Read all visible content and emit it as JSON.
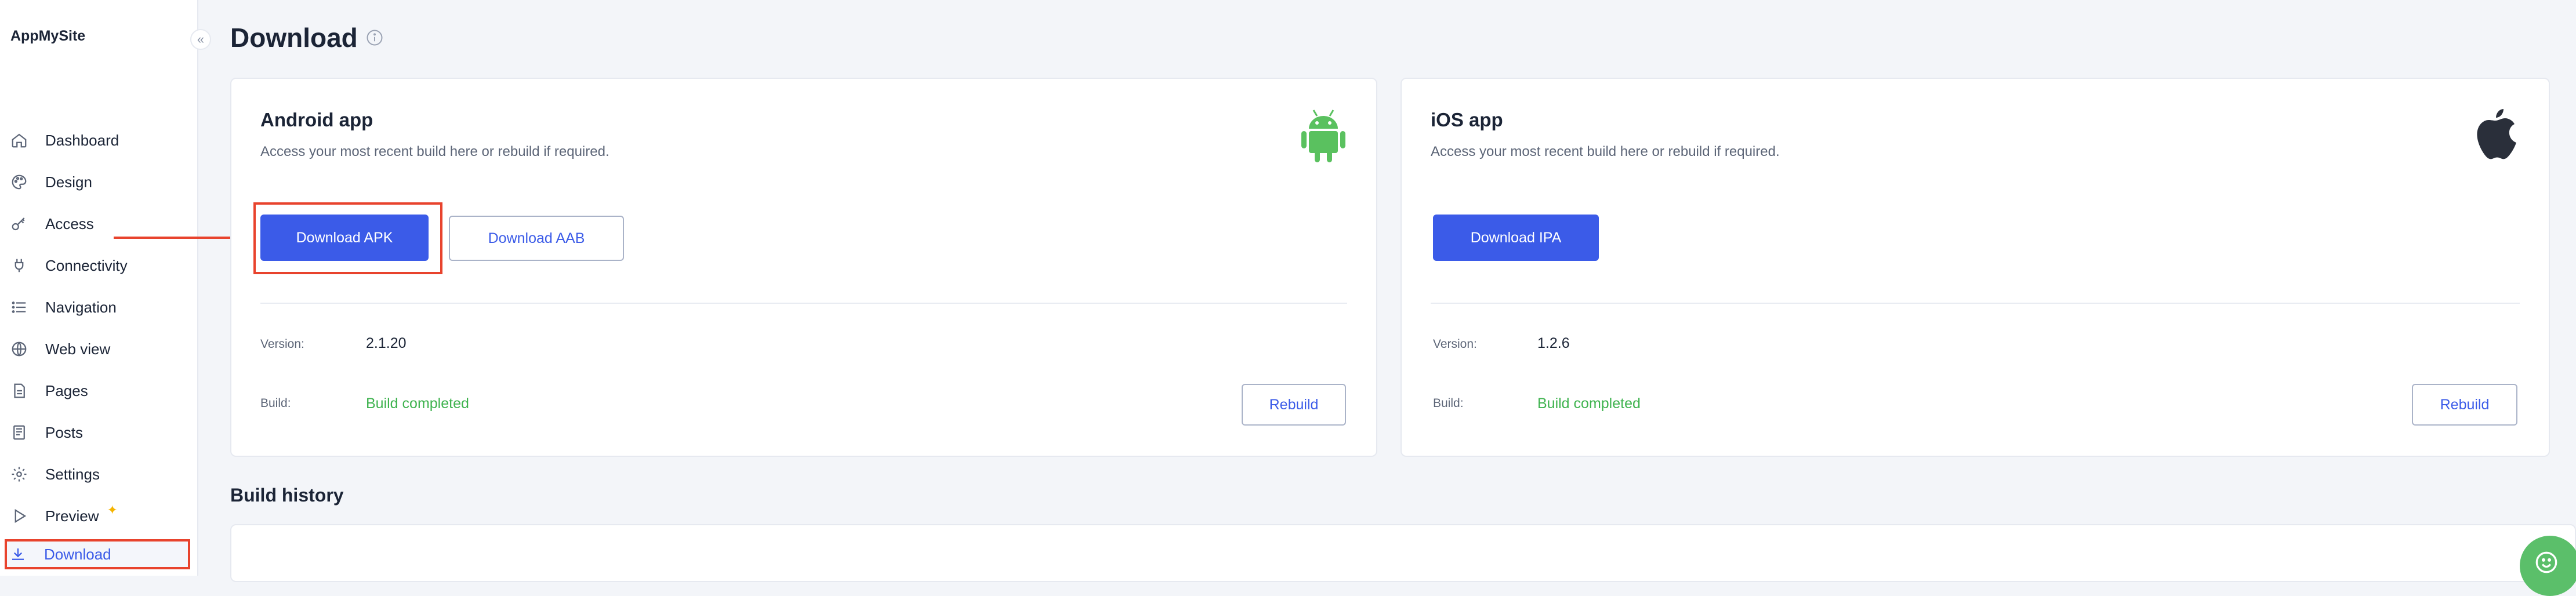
{
  "app": {
    "brand": "AppMySite"
  },
  "sidebar": {
    "collapse_glyph": "«",
    "items": [
      {
        "label": "Dashboard",
        "icon": "home-icon"
      },
      {
        "label": "Design",
        "icon": "palette-icon"
      },
      {
        "label": "Access",
        "icon": "key-icon"
      },
      {
        "label": "Connectivity",
        "icon": "plug-icon"
      },
      {
        "label": "Navigation",
        "icon": "list-icon"
      },
      {
        "label": "Web view",
        "icon": "globe-icon"
      },
      {
        "label": "Pages",
        "icon": "page-icon"
      },
      {
        "label": "Posts",
        "icon": "post-icon"
      },
      {
        "label": "Settings",
        "icon": "gear-icon"
      },
      {
        "label": "Preview",
        "icon": "play-icon",
        "badge": "sparkle-icon"
      },
      {
        "label": "Download",
        "icon": "download-icon",
        "active": true
      }
    ]
  },
  "page": {
    "title": "Download",
    "title_icon": "info-icon"
  },
  "android": {
    "title": "Android app",
    "subtitle": "Access your most recent build here or rebuild if required.",
    "icon": "android-icon",
    "primary_button": "Download APK",
    "secondary_button": "Download AAB",
    "version_label": "Version:",
    "version_value": "2.1.20",
    "build_label": "Build:",
    "build_value": "Build completed",
    "rebuild_button": "Rebuild"
  },
  "ios": {
    "title": "iOS app",
    "subtitle": "Access your most recent build here or rebuild if required.",
    "icon": "apple-icon",
    "primary_button": "Download IPA",
    "version_label": "Version:",
    "version_value": "1.2.6",
    "build_label": "Build:",
    "build_value": "Build completed",
    "rebuild_button": "Rebuild"
  },
  "history": {
    "title": "Build history"
  },
  "colors": {
    "accent": "#3b5be8",
    "success": "#3fb34f",
    "annotation": "#e8432d",
    "android": "#5ac15f"
  }
}
